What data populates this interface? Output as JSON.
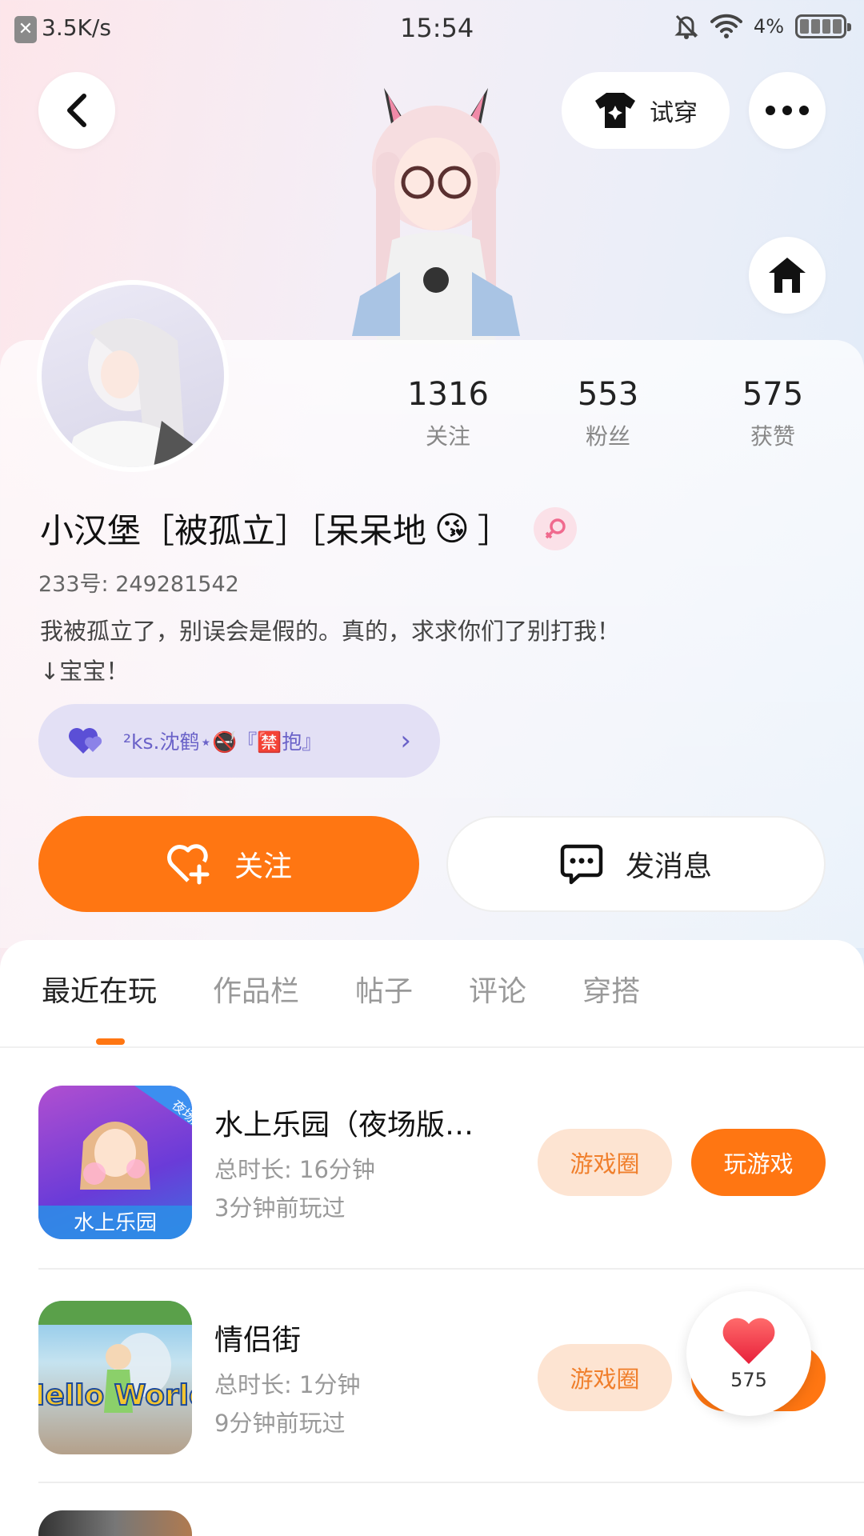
{
  "status_bar": {
    "speed": "3.5K/s",
    "time": "15:54",
    "battery": "4%"
  },
  "top": {
    "try_on_label": "试穿"
  },
  "stats": [
    {
      "value": "1316",
      "label": "关注"
    },
    {
      "value": "553",
      "label": "粉丝"
    },
    {
      "value": "575",
      "label": "获赞"
    }
  ],
  "profile": {
    "nickname": "小汉堡［被孤立］［呆呆地",
    "nickname_emoji": "😘",
    "nickname_end": "］",
    "uid": "233号: 249281542",
    "bio_line1": "我被孤立了，别误会是假的。真的，求求你们了别打我！",
    "bio_line2": "↓宝宝！",
    "relation_tag": "²ks.沈鹤⋆🚭『🈲抱』"
  },
  "actions": {
    "follow": "关注",
    "message": "发消息"
  },
  "tabs": [
    "最近在玩",
    "作品栏",
    "帖子",
    "评论",
    "穿搭"
  ],
  "games": [
    {
      "title": "水上乐园（夜场版…",
      "duration": "总时长: 16分钟",
      "last_played": "3分钟前玩过",
      "icon_text": "水上乐园",
      "badge": "夜场版",
      "circle_btn": "游戏圈",
      "play_btn": "玩游戏"
    },
    {
      "title": "情侣街",
      "duration": "总时长: 1分钟",
      "last_played": "9分钟前玩过",
      "icon_text": "Hello World",
      "circle_btn": "游戏圈"
    }
  ],
  "floating_like": {
    "count": "575"
  },
  "colors": {
    "accent": "#ff7612",
    "accent_light": "#fde4d2",
    "tag_bg": "#e3e0f5",
    "tag_text": "#6a62c8"
  }
}
